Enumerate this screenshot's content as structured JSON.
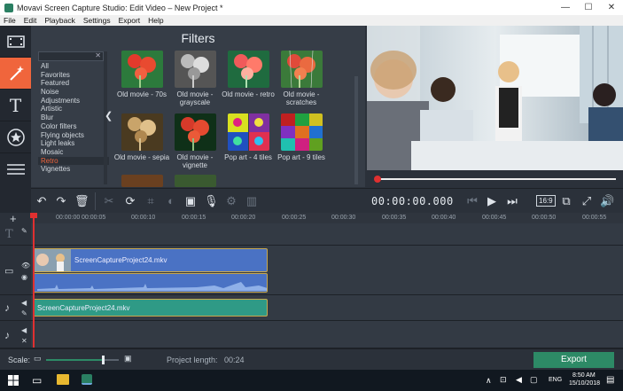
{
  "window": {
    "title": "Movavi Screen Capture Studio: Edit Video – New Project *",
    "minimize": "—",
    "maximize": "☐",
    "close": "✕"
  },
  "menu": [
    "File",
    "Edit",
    "Playback",
    "Settings",
    "Export",
    "Help"
  ],
  "filters": {
    "heading": "Filters",
    "search_placeholder": "",
    "categories": [
      "All",
      "Favorites",
      "Featured",
      "Noise",
      "Adjustments",
      "Artistic",
      "Blur",
      "Color filters",
      "Flying objects",
      "Light leaks",
      "Mosaic",
      "Retro",
      "Vignettes"
    ],
    "selected_category": "Retro",
    "items": [
      {
        "label": "Old movie - 70s"
      },
      {
        "label": "Old movie - grayscale"
      },
      {
        "label": "Old movie - retro"
      },
      {
        "label": "Old movie - scratches"
      },
      {
        "label": "Old movie - sepia"
      },
      {
        "label": "Old movie - vignette"
      },
      {
        "label": "Pop art - 4 tiles"
      },
      {
        "label": "Pop art - 9 tiles"
      }
    ]
  },
  "player": {
    "timecode": "00:00:00.000",
    "aspect_ratio": "16:9",
    "progress": 0.0
  },
  "ruler": {
    "ticks": [
      "00:00:00",
      "00:00:05",
      "00:00:10",
      "00:00:15",
      "00:00:20",
      "00:00:25",
      "00:00:30",
      "00:00:35",
      "00:00:40",
      "00:00:45",
      "00:00:50",
      "00:00:55"
    ]
  },
  "timeline": {
    "video_clip": "ScreenCaptureProject24.mkv",
    "audio_clip": "ScreenCaptureProject24.mkv"
  },
  "bottom": {
    "scale_label": "Scale:",
    "scale_value": 0.78,
    "project_length_label": "Project length:",
    "project_length": "00:24",
    "export_label": "Export"
  },
  "taskbar": {
    "language": "ENG",
    "time": "8:50 AM",
    "date": "15/10/2018"
  },
  "colors": {
    "accent": "#f0653c",
    "export": "#2d8a66",
    "video_clip": "#4a72c4",
    "audio_clip": "#2f9a86",
    "playhead": "#e03030"
  }
}
